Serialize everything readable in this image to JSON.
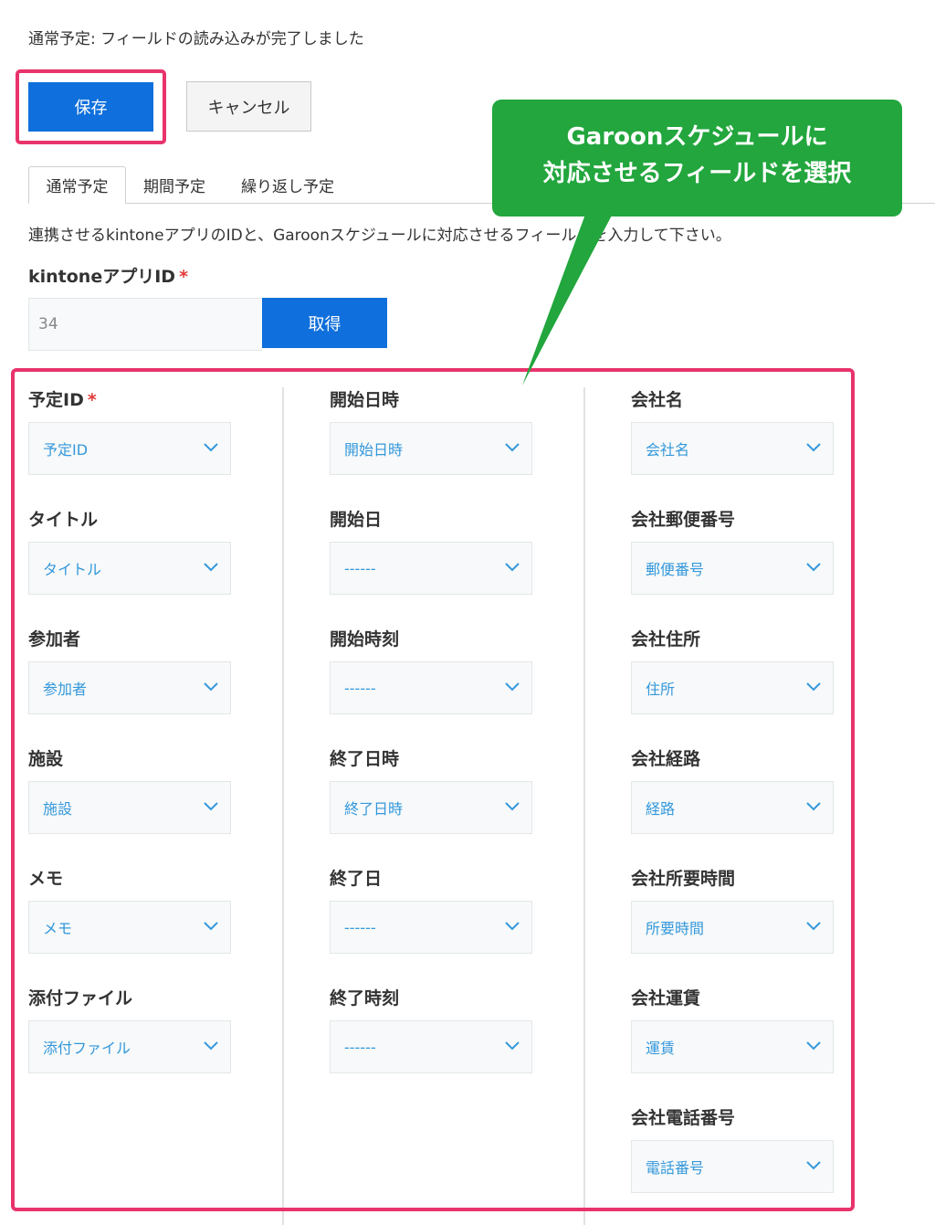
{
  "status_message": "通常予定: フィールドの読み込みが完了しました",
  "buttons": {
    "save": "保存",
    "cancel": "キャンセル",
    "get": "取得"
  },
  "tabs": [
    "通常予定",
    "期間予定",
    "繰り返し予定"
  ],
  "description": "連携させるkintoneアプリのIDと、Garoonスケジュールに対応させるフィールドを入力して下さい。",
  "app_id": {
    "label": "kintoneアプリID",
    "required_mark": "*",
    "value": "34"
  },
  "columns": [
    [
      {
        "label": "予定ID",
        "required": "*",
        "value": "予定ID"
      },
      {
        "label": "タイトル",
        "required": "",
        "value": "タイトル"
      },
      {
        "label": "参加者",
        "required": "",
        "value": "参加者"
      },
      {
        "label": "施設",
        "required": "",
        "value": "施設"
      },
      {
        "label": "メモ",
        "required": "",
        "value": "メモ"
      },
      {
        "label": "添付ファイル",
        "required": "",
        "value": "添付ファイル"
      }
    ],
    [
      {
        "label": "開始日時",
        "value": "開始日時"
      },
      {
        "label": "開始日",
        "value": "------"
      },
      {
        "label": "開始時刻",
        "value": "------"
      },
      {
        "label": "終了日時",
        "value": "終了日時"
      },
      {
        "label": "終了日",
        "value": "------"
      },
      {
        "label": "終了時刻",
        "value": "------"
      }
    ],
    [
      {
        "label": "会社名",
        "value": "会社名"
      },
      {
        "label": "会社郵便番号",
        "value": "郵便番号"
      },
      {
        "label": "会社住所",
        "value": "住所"
      },
      {
        "label": "会社経路",
        "value": "経路"
      },
      {
        "label": "会社所要時間",
        "value": "所要時間"
      },
      {
        "label": "会社運賃",
        "value": "運賃"
      },
      {
        "label": "会社電話番号",
        "value": "電話番号"
      }
    ]
  ],
  "callout": {
    "line1": "Garoonスケジュールに",
    "line2": "対応させるフィールドを選択"
  },
  "colors": {
    "primary": "#0f6fdc",
    "highlight": "#e8336b",
    "callout": "#22a63d",
    "select_text": "#3498db"
  }
}
